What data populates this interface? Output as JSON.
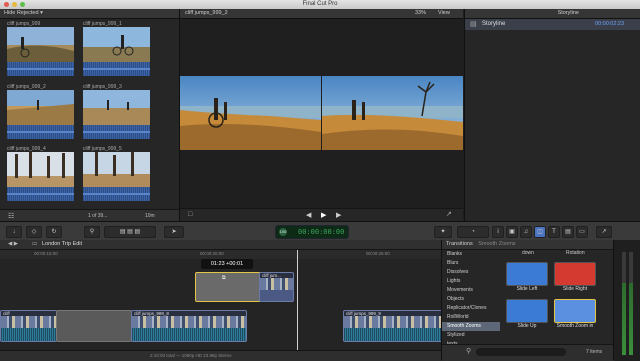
{
  "window": {
    "title": "Final Cut Pro"
  },
  "browser": {
    "filter": "Hide Rejected",
    "clips": [
      {
        "name": "cliff jumps_999"
      },
      {
        "name": "cliff jumps_999_1"
      },
      {
        "name": "cliff jumps_999_2"
      },
      {
        "name": "cliff jumps_999_3"
      },
      {
        "name": "cliff jumps_999_4"
      },
      {
        "name": "cliff jumps_999_5"
      }
    ],
    "count": "1 of 39...",
    "zoom_label": "10m"
  },
  "viewer": {
    "clip_name": "cliff jumps_999_2",
    "zoom": "33%",
    "view_label": "View"
  },
  "inspector": {
    "header": "Storyline",
    "row_label": "Storyline",
    "timecode": "00:00:02:23"
  },
  "toolbar": {
    "timecode_pct": "100",
    "timecode": "00:00:00:00"
  },
  "timeline": {
    "project": "London Trip Edit",
    "ruler": [
      "00:00:15:00",
      "00:00:20:00",
      "00:00:25:00"
    ],
    "tooltip_dur": "01:23",
    "tooltip_delta": "+00:01",
    "clips": [
      {
        "name": "cliff jumps_999_8"
      },
      {
        "name": "cliff jumps_999_9"
      },
      {
        "name": "cliff jum..."
      },
      {
        "name": "cliff"
      }
    ],
    "status": "2:10:00 total — 1080p HD 23.98p Stereo"
  },
  "transitions": {
    "title": "Transitions",
    "subtitle": "Smooth Zooms",
    "categories": [
      "Blanks",
      "Blurs",
      "Dissolves",
      "Lights",
      "Movements",
      "Objects",
      "Replicator/Clones",
      "RollWorld",
      "Smooth Zooms",
      "Stylized",
      "tests"
    ],
    "selected": "Smooth Zooms",
    "top_labels": [
      "down",
      "Rotation"
    ],
    "tiles": [
      {
        "label": "Slide Left",
        "color": "#3b7bd6"
      },
      {
        "label": "Slide Right",
        "color": "#d43a2f"
      },
      {
        "label": "Slide Up",
        "color": "#3b7bd6"
      },
      {
        "label": "Smooth Zoom in",
        "color": "#5b8fe0"
      }
    ],
    "count": "7 items"
  }
}
